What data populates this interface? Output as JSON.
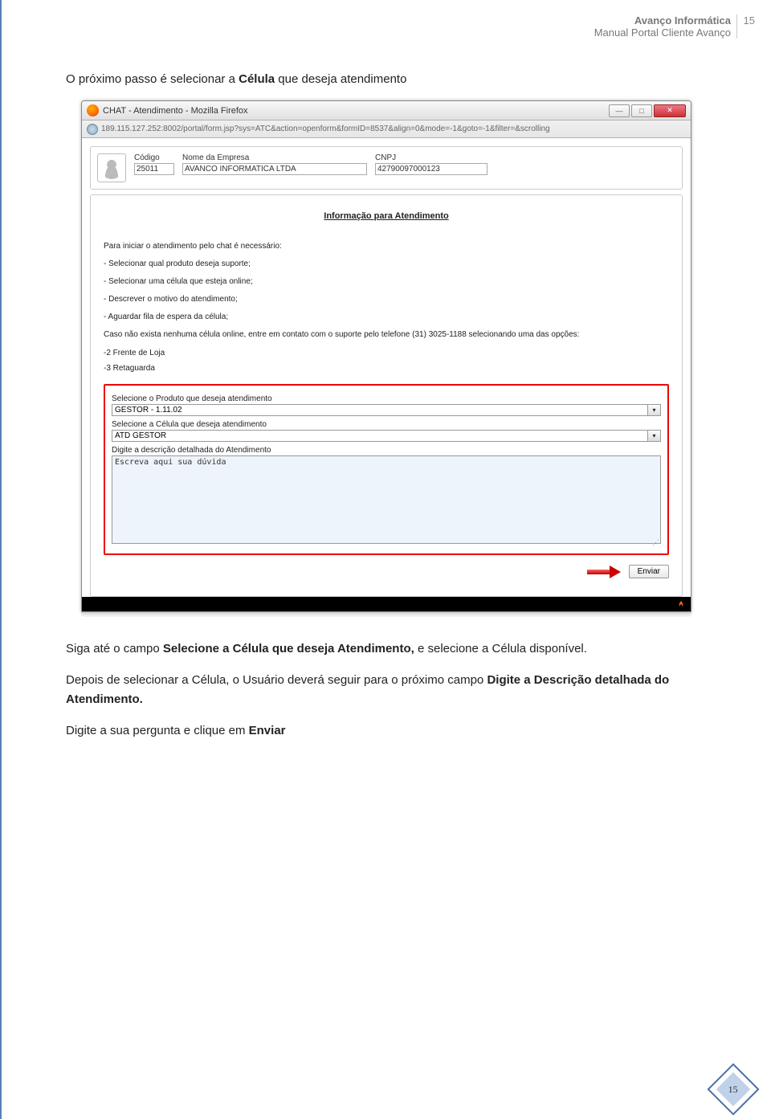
{
  "header": {
    "company": "Avanço Informática",
    "manual": "Manual Portal Cliente Avanço",
    "page_top": "15"
  },
  "intro": {
    "prefix": "O próximo passo é selecionar a ",
    "bold": "Célula ",
    "suffix": "que deseja atendimento"
  },
  "window": {
    "title": "CHAT - Atendimento - Mozilla Firefox",
    "url": "189.115.127.252:8002/portal/form.jsp?sys=ATC&action=openform&formID=8537&align=0&mode=-1&goto=-1&filter=&scrolling",
    "win_minimize": "—",
    "win_max": "□",
    "win_close": "✕"
  },
  "top_fields": {
    "codigo_label": "Código",
    "codigo_value": "25011",
    "empresa_label": "Nome da Empresa",
    "empresa_value": "AVANCO INFORMATICA LTDA",
    "cnpj_label": "CNPJ",
    "cnpj_value": "42790097000123"
  },
  "info_title": "Informação  para  Atendimento",
  "instructions": {
    "intro": "Para  iniciar o  atendimento  pelo  chat  é  necessário:",
    "b1": "-  Selecionar  qual  produto  deseja  suporte;",
    "b2": "-  Selecionar  uma  célula  que  esteja  online;",
    "b3": "-  Descrever  o  motivo  do  atendimento;",
    "b4": "-  Aguardar  fila  de  espera  da  célula;",
    "contact": "Caso  não  exista  nenhuma  célula  online,  entre  em  contato  com o  suporte  pelo  telefone  (31)  3025-1188 selecionando uma das opções:",
    "opt1": "-2 Frente de Loja",
    "opt2": "-3 Retaguarda"
  },
  "form": {
    "produto_label": "Selecione o Produto que deseja atendimento",
    "produto_value": "GESTOR - 1.11.02",
    "celula_label": "Selecione a Célula que deseja atendimento",
    "celula_value": "ATD GESTOR",
    "descricao_label": "Digite a descrição detalhada do Atendimento",
    "descricao_value": "Escreva aqui sua dúvida",
    "enviar": "Enviar"
  },
  "body": {
    "p1_a": "Siga até o campo ",
    "p1_b": "Selecione a Célula que deseja Atendimento, ",
    "p1_c": "e selecione a Célula disponível.",
    "p2_a": "Depois de selecionar a Célula, o Usuário deverá seguir para o próximo campo ",
    "p2_b": "Digite a Descrição detalhada do Atendimento.",
    "p3_a": "Digite a sua pergunta e clique em ",
    "p3_b": "Enviar"
  },
  "page_bottom": "15"
}
